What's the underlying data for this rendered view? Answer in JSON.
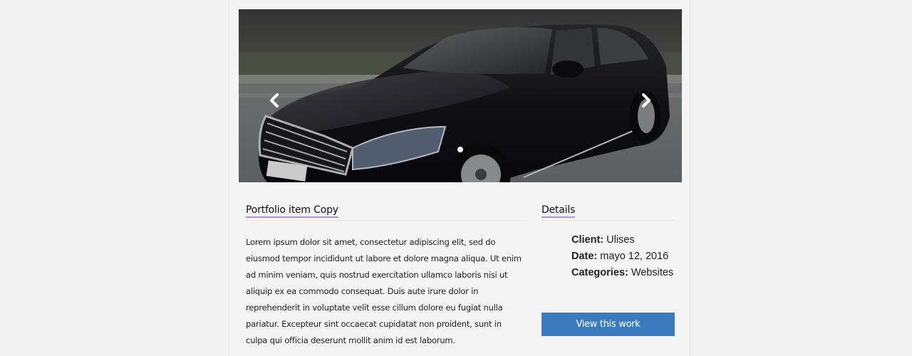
{
  "slider": {
    "image_subject": "black luxury sedan parked on a road",
    "prev_icon": "chevron-left-icon",
    "next_icon": "chevron-right-icon",
    "slide_count": 1,
    "active_slide": 1
  },
  "portfolio": {
    "title": "Portfolio item Copy",
    "description": "Lorem ipsum dolor sit amet, consectetur adipiscing elit, sed do eiusmod tempor incididunt ut labore et dolore magna aliqua. Ut enim ad minim veniam, quis nostrud exercitation ullamco laboris nisi ut aliquip ex ea commodo consequat. Duis aute irure dolor in reprehenderit in voluptate velit esse cillum dolore eu fugiat nulla pariatur. Excepteur sint occaecat cupidatat non proident, sunt in culpa qui officia deserunt mollit anim id est laborum."
  },
  "details": {
    "title": "Details",
    "client_label": "Client:",
    "client_value": "Ulises",
    "date_label": "Date:",
    "date_value": "mayo 12, 2016",
    "categories_label": "Categories:",
    "categories_value": "Websites",
    "button_label": "View this work"
  },
  "colors": {
    "accent_underline": "#b28fd6",
    "button_bg": "#3a7bbf",
    "page_bg": "#f1f1f1"
  }
}
